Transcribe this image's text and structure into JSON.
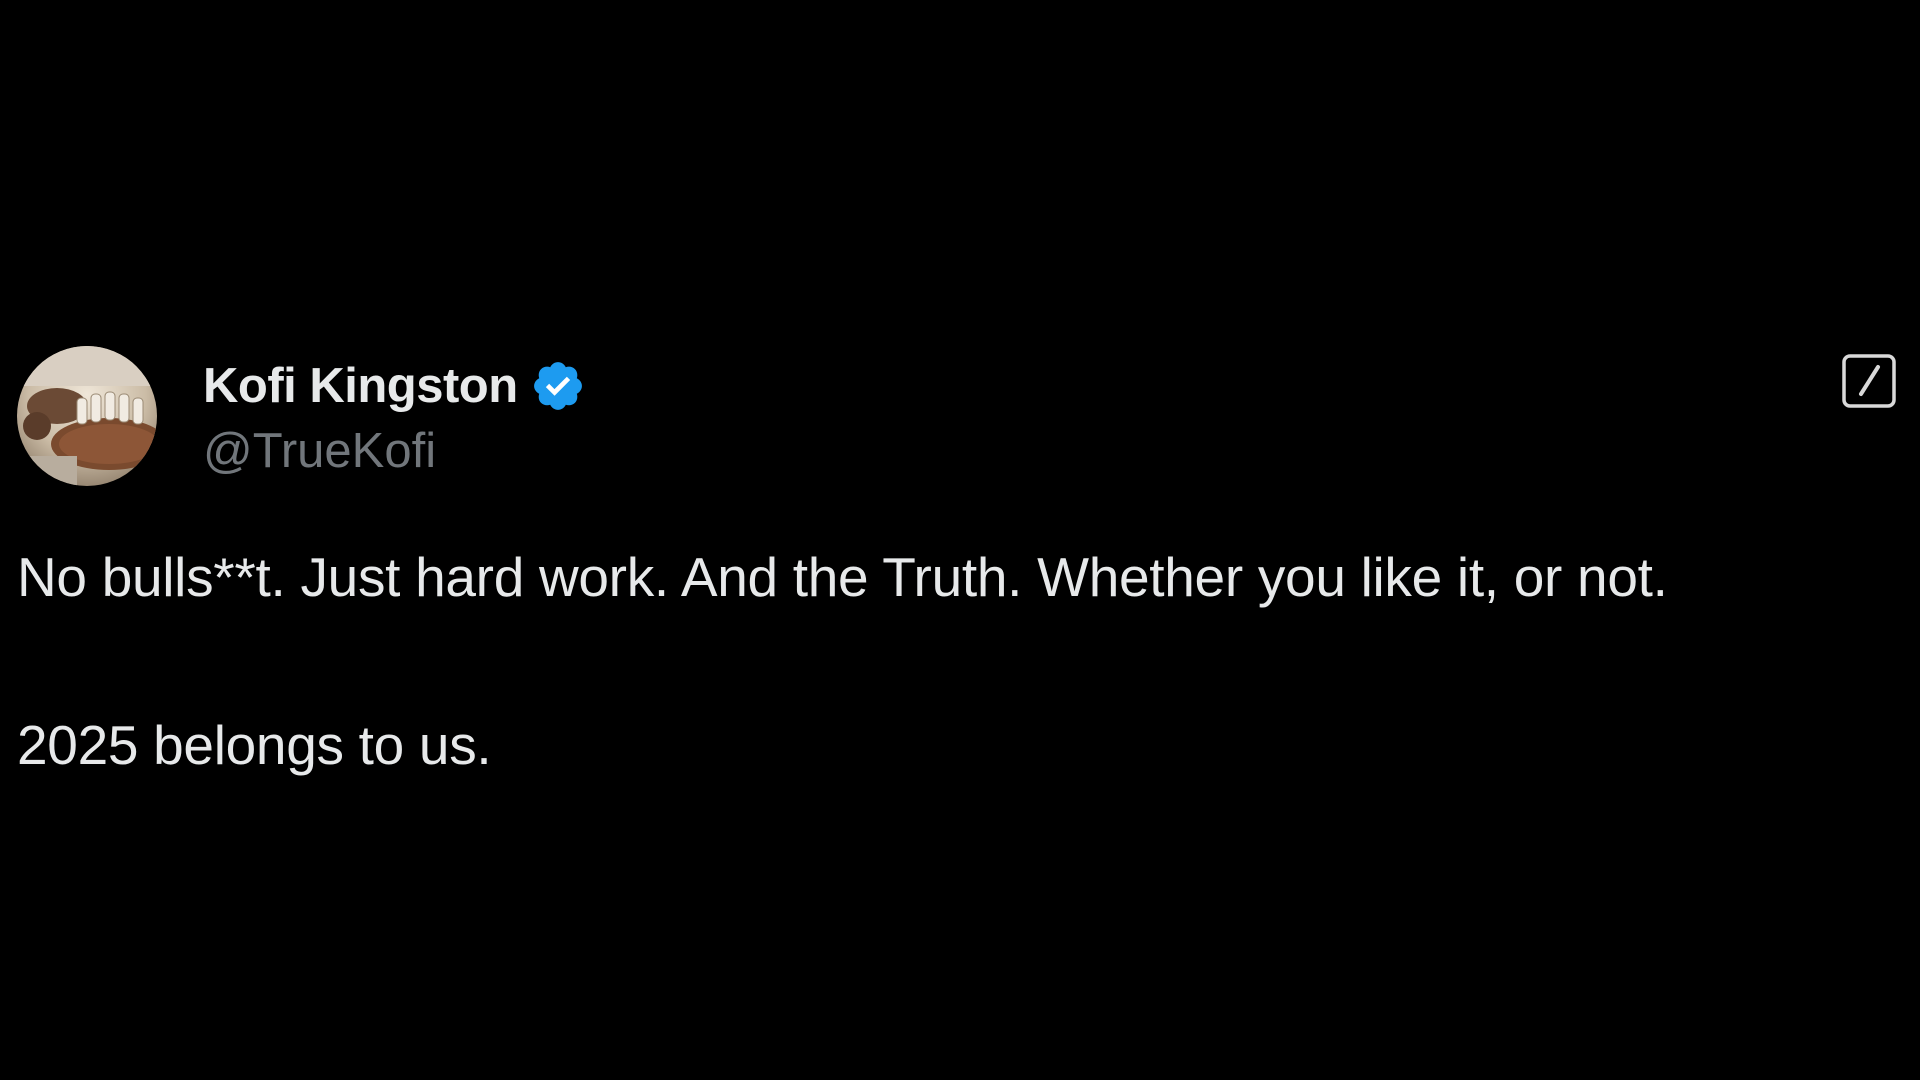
{
  "author": {
    "display_name": "Kofi Kingston",
    "handle": "@TrueKofi",
    "verified_icon": "verified-badge-icon",
    "avatar_icon": "avatar"
  },
  "logo": {
    "icon": "x-logo-icon"
  },
  "tweet": {
    "line1": "No bulls**t. Just hard work. And the Truth. Whether you like it, or not.",
    "line2": "2025 belongs to us."
  },
  "colors": {
    "background": "#000000",
    "primary_text": "#e7e9ea",
    "secondary_text": "#71767b",
    "verified_blue": "#1d9bf0"
  }
}
